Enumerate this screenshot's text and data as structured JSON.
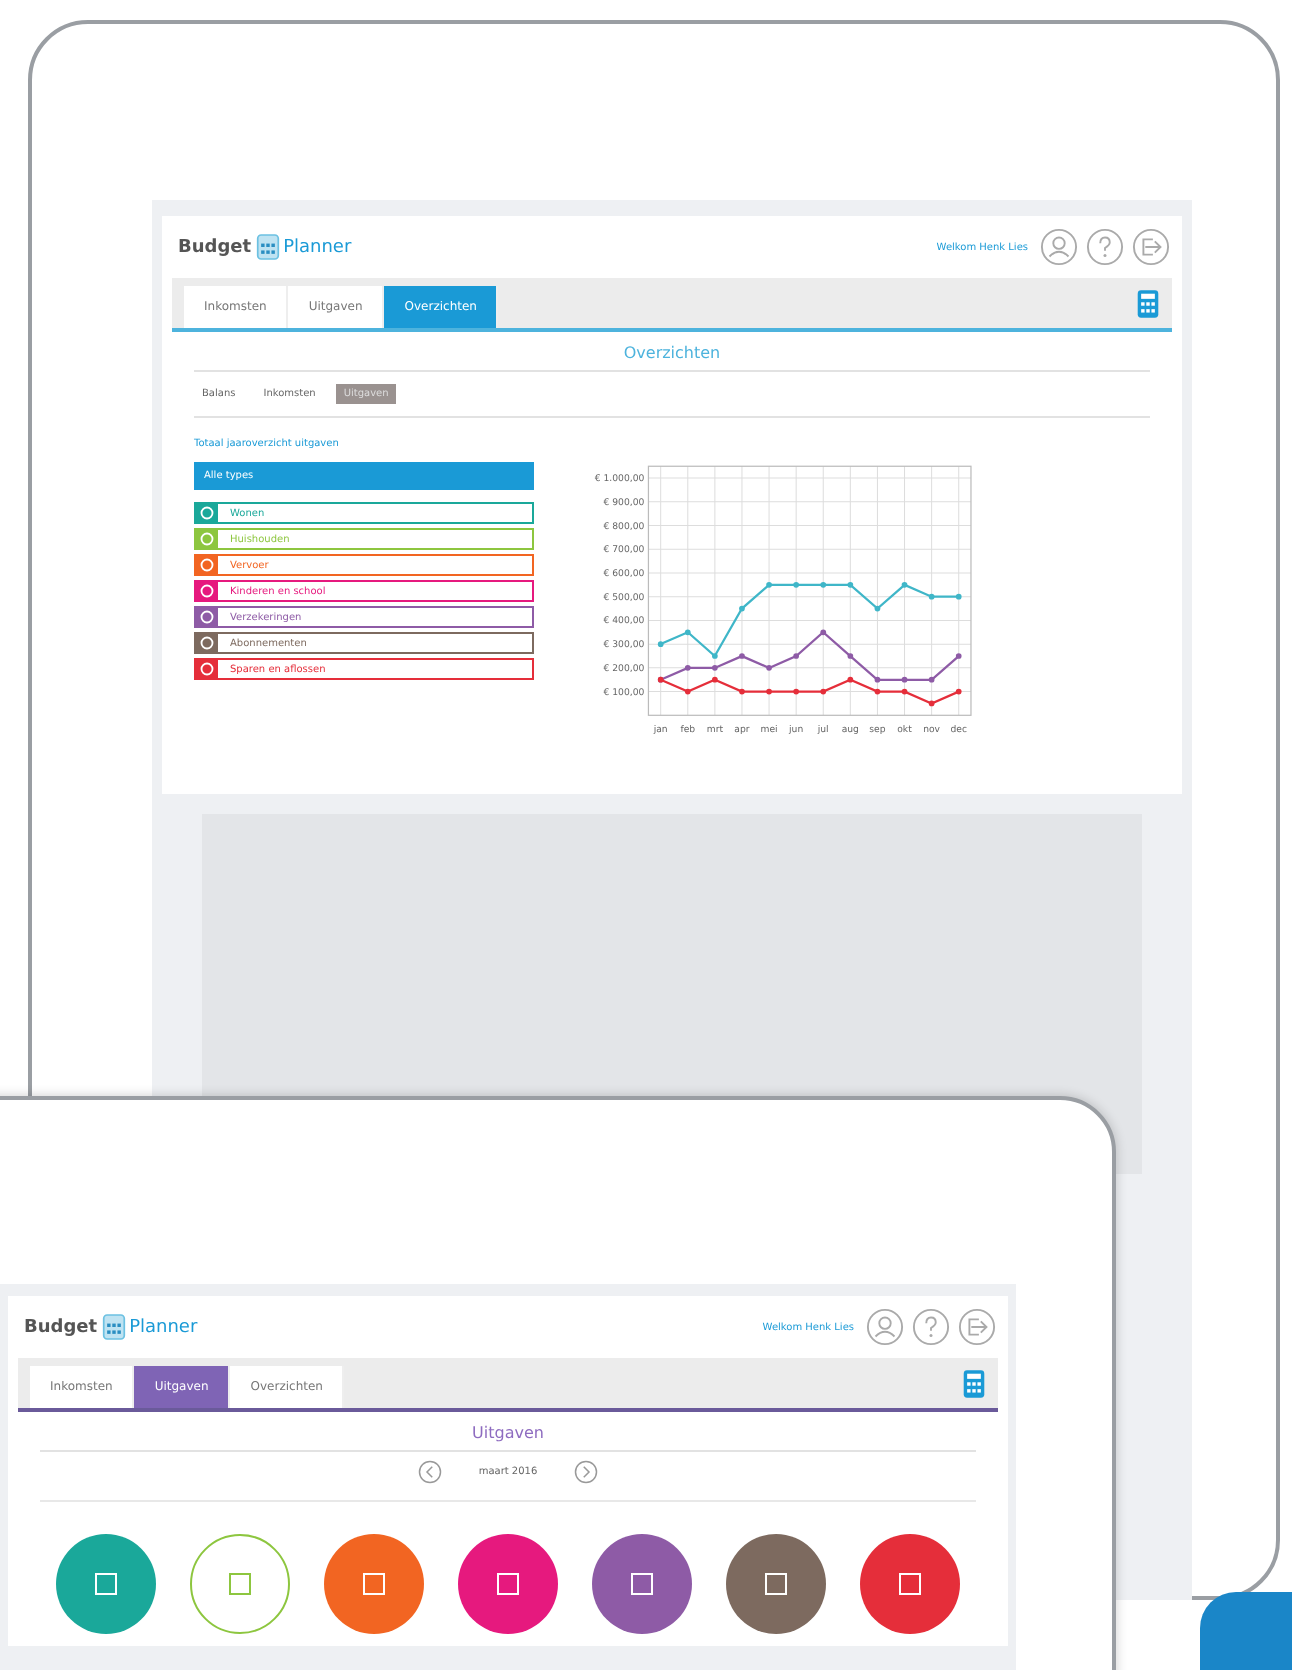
{
  "back_tablet": {
    "header": {
      "logo_left": "Budget",
      "logo_right": "Planner",
      "welcome": "Welkom Henk Lies"
    },
    "tabs": [
      {
        "label": "Inkomsten",
        "selected": false
      },
      {
        "label": "Uitgaven",
        "selected": false
      },
      {
        "label": "Overzichten",
        "selected": true
      }
    ],
    "heading": "Overzichten",
    "subtabs": [
      {
        "label": "Balans",
        "selected": false
      },
      {
        "label": "Inkomsten",
        "selected": false
      },
      {
        "label": "Uitgaven",
        "selected": true
      }
    ],
    "section_title": "Totaal jaaroverzicht uitgaven",
    "categories": [
      {
        "label": "Alle types",
        "selected": true,
        "color": "#1a9ad6"
      },
      {
        "label": "Wonen",
        "selected": false,
        "color": "#1aa89a"
      },
      {
        "label": "Huishouden",
        "selected": false,
        "color": "#8dc63f"
      },
      {
        "label": "Vervoer",
        "selected": false,
        "color": "#f26522"
      },
      {
        "label": "Kinderen en school",
        "selected": false,
        "color": "#e6197e"
      },
      {
        "label": "Verzekeringen",
        "selected": false,
        "color": "#8e5ba6"
      },
      {
        "label": "Abonnementen",
        "selected": false,
        "color": "#7d6a5f"
      },
      {
        "label": "Sparen en aflossen",
        "selected": false,
        "color": "#e52e3a"
      }
    ],
    "chart_data": {
      "type": "line",
      "categories": [
        "jan",
        "feb",
        "mrt",
        "apr",
        "mei",
        "jun",
        "jul",
        "aug",
        "sep",
        "okt",
        "nov",
        "dec"
      ],
      "ylim": [
        0,
        1050
      ],
      "grid": true,
      "yticks": [
        {
          "value": 100,
          "label": "€ 100,00"
        },
        {
          "value": 200,
          "label": "€ 200,00"
        },
        {
          "value": 300,
          "label": "€ 300,00"
        },
        {
          "value": 400,
          "label": "€ 400,00"
        },
        {
          "value": 500,
          "label": "€ 500,00"
        },
        {
          "value": 600,
          "label": "€ 600,00"
        },
        {
          "value": 700,
          "label": "€ 700,00"
        },
        {
          "value": 800,
          "label": "€ 800,00"
        },
        {
          "value": 900,
          "label": "€ 900,00"
        },
        {
          "value": 1000,
          "label": "€ 1.000,00"
        }
      ],
      "series": [
        {
          "color": "#3fb6c8",
          "values": [
            300,
            350,
            250,
            450,
            550,
            550,
            550,
            550,
            450,
            550,
            500,
            500
          ]
        },
        {
          "color": "#8e5ba6",
          "values": [
            150,
            200,
            200,
            250,
            200,
            250,
            350,
            250,
            150,
            150,
            150,
            250
          ]
        },
        {
          "color": "#e52e3a",
          "values": [
            150,
            100,
            150,
            100,
            100,
            100,
            100,
            150,
            100,
            100,
            50,
            100
          ]
        }
      ]
    }
  },
  "front_tablet": {
    "header": {
      "logo_left": "Budget",
      "logo_right": "Planner",
      "welcome": "Welkom Henk Lies"
    },
    "tabs": [
      {
        "label": "Inkomsten",
        "selected": false
      },
      {
        "label": "Uitgaven",
        "selected": true
      },
      {
        "label": "Overzichten",
        "selected": false
      }
    ],
    "heading": "Uitgaven",
    "month": "maart 2016",
    "category_circles": [
      {
        "color": "#1aa89a",
        "outlined": false
      },
      {
        "color": "#8dc63f",
        "outlined": true
      },
      {
        "color": "#f26522",
        "outlined": false
      },
      {
        "color": "#e6197e",
        "outlined": false
      },
      {
        "color": "#8e5ba6",
        "outlined": false
      },
      {
        "color": "#7d6a5f",
        "outlined": false
      },
      {
        "color": "#e52e3a",
        "outlined": false
      }
    ]
  }
}
